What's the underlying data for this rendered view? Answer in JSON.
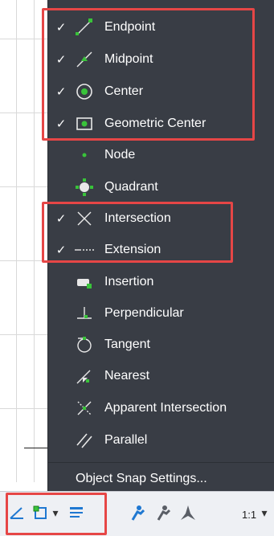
{
  "menu": {
    "items": [
      {
        "label": "Endpoint",
        "checked": true,
        "icon": "endpoint-icon"
      },
      {
        "label": "Midpoint",
        "checked": true,
        "icon": "midpoint-icon"
      },
      {
        "label": "Center",
        "checked": true,
        "icon": "center-icon"
      },
      {
        "label": "Geometric Center",
        "checked": true,
        "icon": "geometric-center-icon"
      },
      {
        "label": "Node",
        "checked": false,
        "icon": "node-icon"
      },
      {
        "label": "Quadrant",
        "checked": false,
        "icon": "quadrant-icon"
      },
      {
        "label": "Intersection",
        "checked": true,
        "icon": "intersection-icon"
      },
      {
        "label": "Extension",
        "checked": true,
        "icon": "extension-icon"
      },
      {
        "label": "Insertion",
        "checked": false,
        "icon": "insertion-icon"
      },
      {
        "label": "Perpendicular",
        "checked": false,
        "icon": "perpendicular-icon"
      },
      {
        "label": "Tangent",
        "checked": false,
        "icon": "tangent-icon"
      },
      {
        "label": "Nearest",
        "checked": false,
        "icon": "nearest-icon"
      },
      {
        "label": "Apparent Intersection",
        "checked": false,
        "icon": "apparent-intersection-icon"
      },
      {
        "label": "Parallel",
        "checked": false,
        "icon": "parallel-icon"
      }
    ],
    "check_glyph": "✓",
    "settings_label": "Object Snap Settings..."
  },
  "statusbar": {
    "scale_label": "1:1",
    "chevron": "▾"
  },
  "colors": {
    "menu_bg": "#393d45",
    "highlight": "#e64646",
    "accent": "#1f78d1",
    "snap_green": "#39c33a"
  }
}
